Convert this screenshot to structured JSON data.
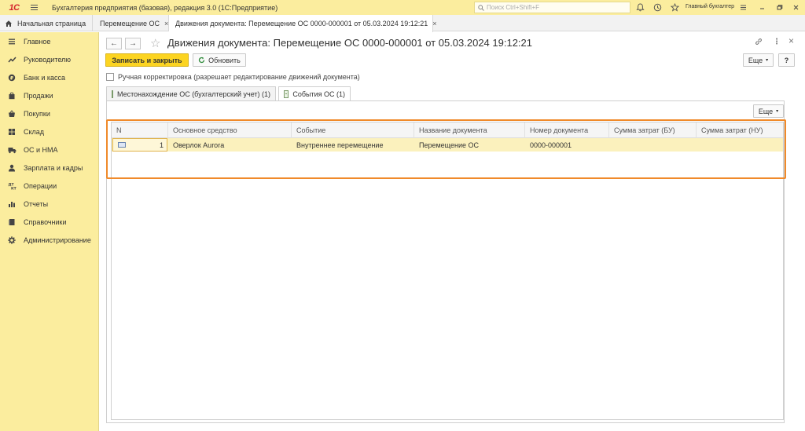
{
  "app": {
    "logo_text": "1С",
    "title": "Бухгалтерия предприятия (базовая), редакция 3.0  (1С:Предприятие)",
    "search_placeholder": "Поиск Ctrl+Shift+F",
    "user": "Главный бухгалтер"
  },
  "tabs": {
    "home": "Начальная страница",
    "items": [
      {
        "label": "Перемещение ОС",
        "close": "×"
      },
      {
        "label": "Движения документа: Перемещение ОС 0000-000001 от 05.03.2024 19:12:21",
        "close": "×"
      }
    ]
  },
  "sidebar": {
    "items": [
      {
        "label": "Главное",
        "icon": "list-icon"
      },
      {
        "label": "Руководителю",
        "icon": "trend-icon"
      },
      {
        "label": "Банк и касса",
        "icon": "coin-icon"
      },
      {
        "label": "Продажи",
        "icon": "bag-icon"
      },
      {
        "label": "Покупки",
        "icon": "basket-icon"
      },
      {
        "label": "Склад",
        "icon": "warehouse-icon"
      },
      {
        "label": "ОС и НМА",
        "icon": "truck-icon"
      },
      {
        "label": "Зарплата и кадры",
        "icon": "person-icon"
      },
      {
        "label": "Операции",
        "icon": "dt-kt-icon"
      },
      {
        "label": "Отчеты",
        "icon": "bar-chart-icon"
      },
      {
        "label": "Справочники",
        "icon": "book-icon"
      },
      {
        "label": "Администрирование",
        "icon": "gear-icon"
      }
    ]
  },
  "form": {
    "back": "←",
    "forward": "→",
    "star": "☆",
    "title": "Движения документа: Перемещение ОС 0000-000001 от 05.03.2024 19:12:21",
    "link_icon": "🔗",
    "more_icon": "⋮",
    "close_icon": "×",
    "save_close": "Записать и закрыть",
    "refresh": "Обновить",
    "more": "Еще",
    "help": "?",
    "manual_correction": "Ручная корректировка (разрешает редактирование движений документа)",
    "form_tabs": [
      {
        "label": "Местонахождение ОС (бухгалтерский учет) (1)"
      },
      {
        "label": "События ОС (1)"
      }
    ],
    "table_more": "Еще"
  },
  "table": {
    "columns": [
      "N",
      "Основное средство",
      "Событие",
      "Название документа",
      "Номер документа",
      "Сумма затрат (БУ)",
      "Сумма затрат (НУ)"
    ],
    "rows": [
      {
        "n": "1",
        "asset": "Оверлок Aurora",
        "event": "Внутреннее перемещение",
        "doc_name": "Перемещение ОС",
        "doc_number": "0000-000001",
        "cost_bu": "",
        "cost_nu": ""
      }
    ]
  }
}
